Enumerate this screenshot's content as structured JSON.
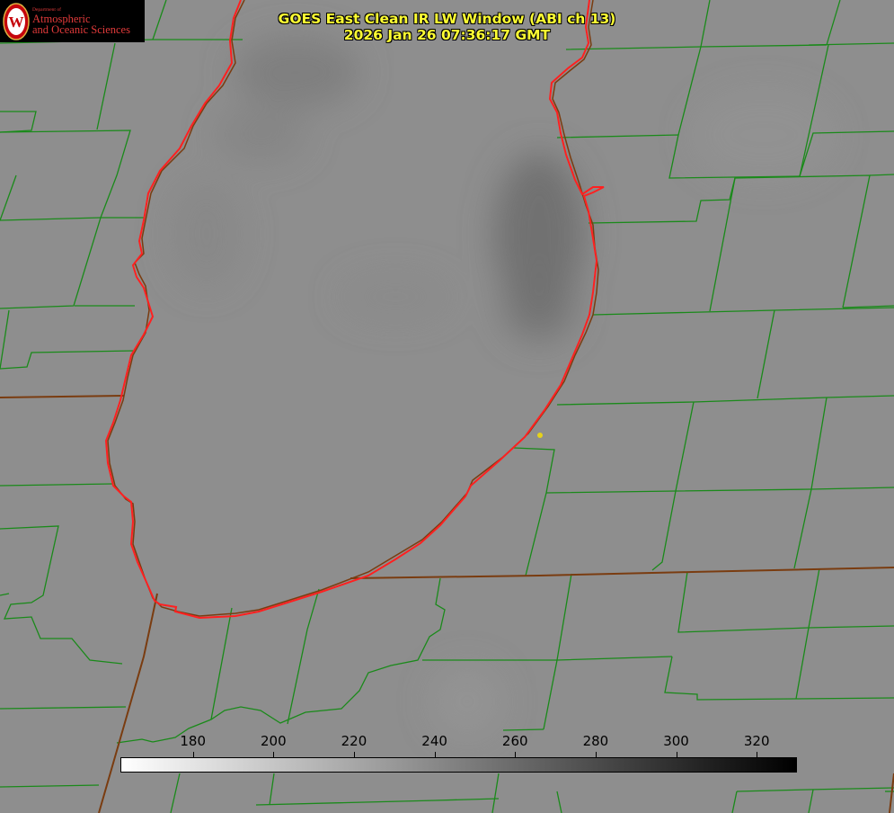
{
  "title": {
    "line1": "GOES East Clean IR LW Window (ABI ch 13)",
    "line2": "2026 Jan 26 07:36:17 GMT"
  },
  "logo": {
    "dept": "Department of",
    "line1": "Atmospheric",
    "line2": "and Oceanic Sciences",
    "seal_letter": "W"
  },
  "colorbar": {
    "min": 162,
    "max": 330,
    "ticks": [
      {
        "value": 180,
        "label": "180"
      },
      {
        "value": 200,
        "label": "200"
      },
      {
        "value": 220,
        "label": "220"
      },
      {
        "value": 240,
        "label": "240"
      },
      {
        "value": 260,
        "label": "260"
      },
      {
        "value": 280,
        "label": "280"
      },
      {
        "value": 300,
        "label": "300"
      },
      {
        "value": 320,
        "label": "320"
      }
    ]
  },
  "colors": {
    "shoreline": "#ff2020",
    "boundaries": "#1a8a1a",
    "state_lines": "#7a3c10",
    "title_text": "#ffff33",
    "logo_text": "#e03a3a",
    "station_marker": "#e6d21a"
  }
}
